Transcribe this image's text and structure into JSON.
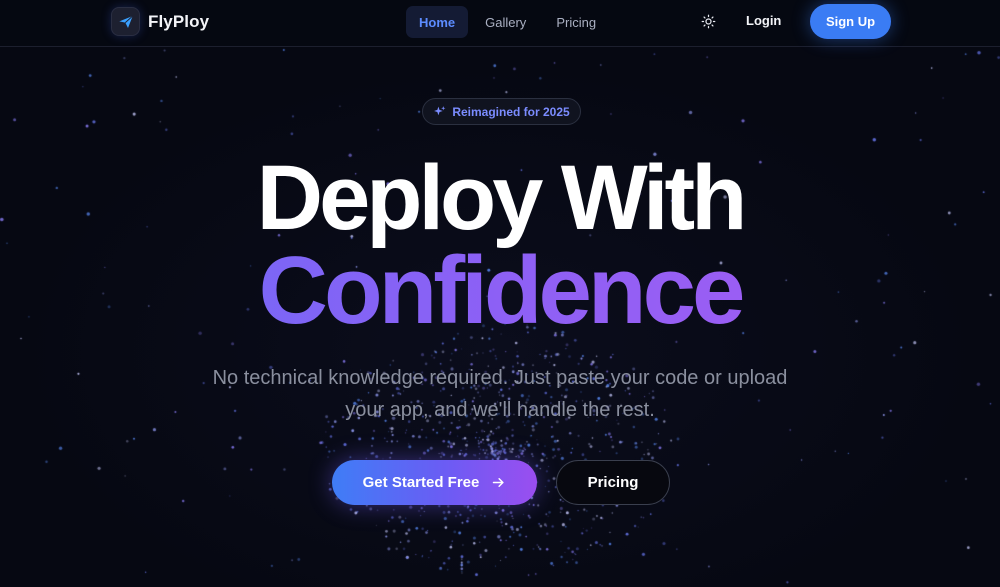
{
  "brand": {
    "name": "FlyPloy",
    "logo_icon": "paper-plane-icon"
  },
  "nav": {
    "links": [
      {
        "label": "Home",
        "active": true
      },
      {
        "label": "Gallery",
        "active": false
      },
      {
        "label": "Pricing",
        "active": false
      }
    ],
    "theme_icon": "sun-icon",
    "login_label": "Login",
    "signup_label": "Sign Up"
  },
  "hero": {
    "badge_icon": "sparkles-icon",
    "badge_label": "Reimagined for 2025",
    "title_line1": "Deploy With",
    "title_line2": "Confidence",
    "subtitle": "No technical knowledge required. Just paste your code or upload your app, and we'll handle the rest.",
    "cta_primary_label": "Get Started Free",
    "cta_primary_icon": "arrow-right-icon",
    "cta_secondary_label": "Pricing"
  },
  "colors": {
    "background": "#060812",
    "accent_blue": "#3a7cf4",
    "accent_purple": "#9a4ef0",
    "nav_active_text": "#5c8cff",
    "badge_text": "#7b8cff"
  }
}
